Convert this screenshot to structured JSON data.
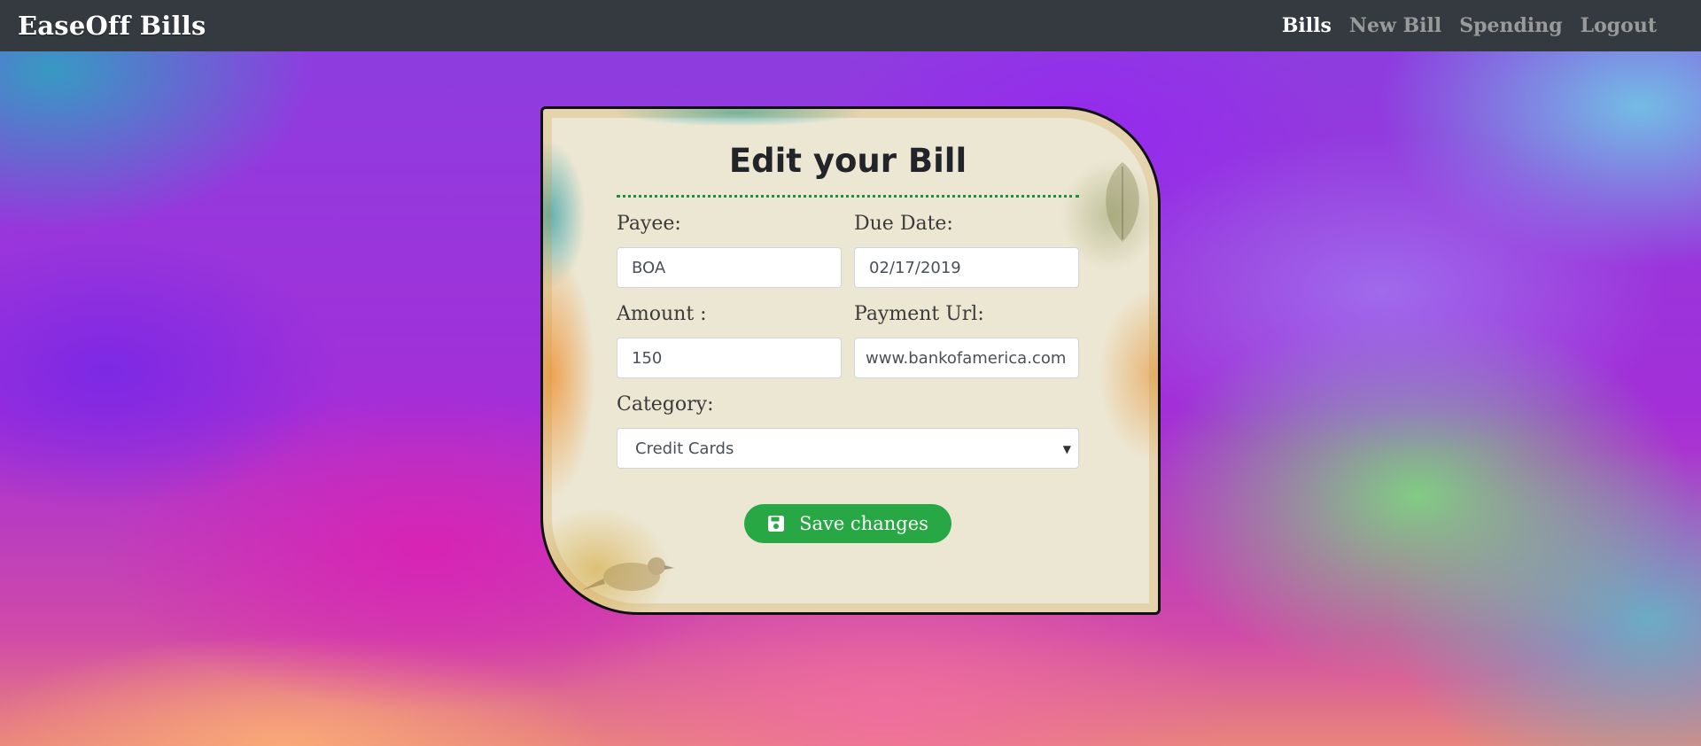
{
  "navbar": {
    "brand": "EaseOff Bills",
    "links": [
      {
        "label": "Bills",
        "active": true
      },
      {
        "label": "New Bill",
        "active": false
      },
      {
        "label": "Spending",
        "active": false
      },
      {
        "label": "Logout",
        "active": false
      }
    ]
  },
  "form": {
    "title": "Edit your Bill",
    "payee": {
      "label": "Payee:",
      "value": "BOA"
    },
    "due_date": {
      "label": "Due Date:",
      "value": "02/17/2019"
    },
    "amount": {
      "label": "Amount :",
      "value": "150"
    },
    "payment_url": {
      "label": "Payment Url:",
      "value": "www.bankofamerica.com"
    },
    "category": {
      "label": "Category:",
      "value": "Credit Cards"
    },
    "save_label": "Save changes",
    "save_icon": "floppy-disk-icon"
  },
  "colors": {
    "navbar_bg": "#343a40",
    "accent_green": "#28a745",
    "divider": "#1e8f3a"
  }
}
